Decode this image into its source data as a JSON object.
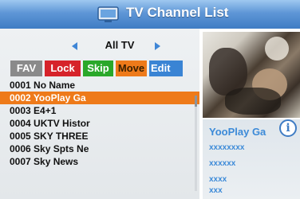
{
  "header": {
    "title": "TV Channel List",
    "icon": "tv-icon"
  },
  "group": {
    "label": "All TV",
    "prev_icon": "arrow-left-icon",
    "next_icon": "arrow-right-icon"
  },
  "buttons": {
    "fav": "FAV",
    "lock": "Lock",
    "skip": "Skip",
    "move": "Move",
    "edit": "Edit"
  },
  "colors": {
    "title_bar": "#4f8ad0",
    "fav": "#8a8a8a",
    "lock": "#d6232a",
    "skip": "#2aa82a",
    "move": "#ee7a1a",
    "edit": "#3a84d4",
    "selection": "#ee7a1a",
    "info_text": "#3c8ad8"
  },
  "channels": [
    {
      "label": "0001 No Name",
      "selected": false
    },
    {
      "label": "0002 YooPlay Ga",
      "selected": true
    },
    {
      "label": "0003 E4+1",
      "selected": false
    },
    {
      "label": "0004 UKTV Histor",
      "selected": false
    },
    {
      "label": "0005 SKY THREE",
      "selected": false
    },
    {
      "label": "0006 Sky Spts Ne",
      "selected": false
    },
    {
      "label": "0007 Sky News",
      "selected": false
    }
  ],
  "info": {
    "channel_name": "YooPlay Ga",
    "info_icon": "i",
    "lines": [
      "xxxxxxxx",
      "xxxxxx",
      "xxxx",
      "xxx"
    ]
  }
}
